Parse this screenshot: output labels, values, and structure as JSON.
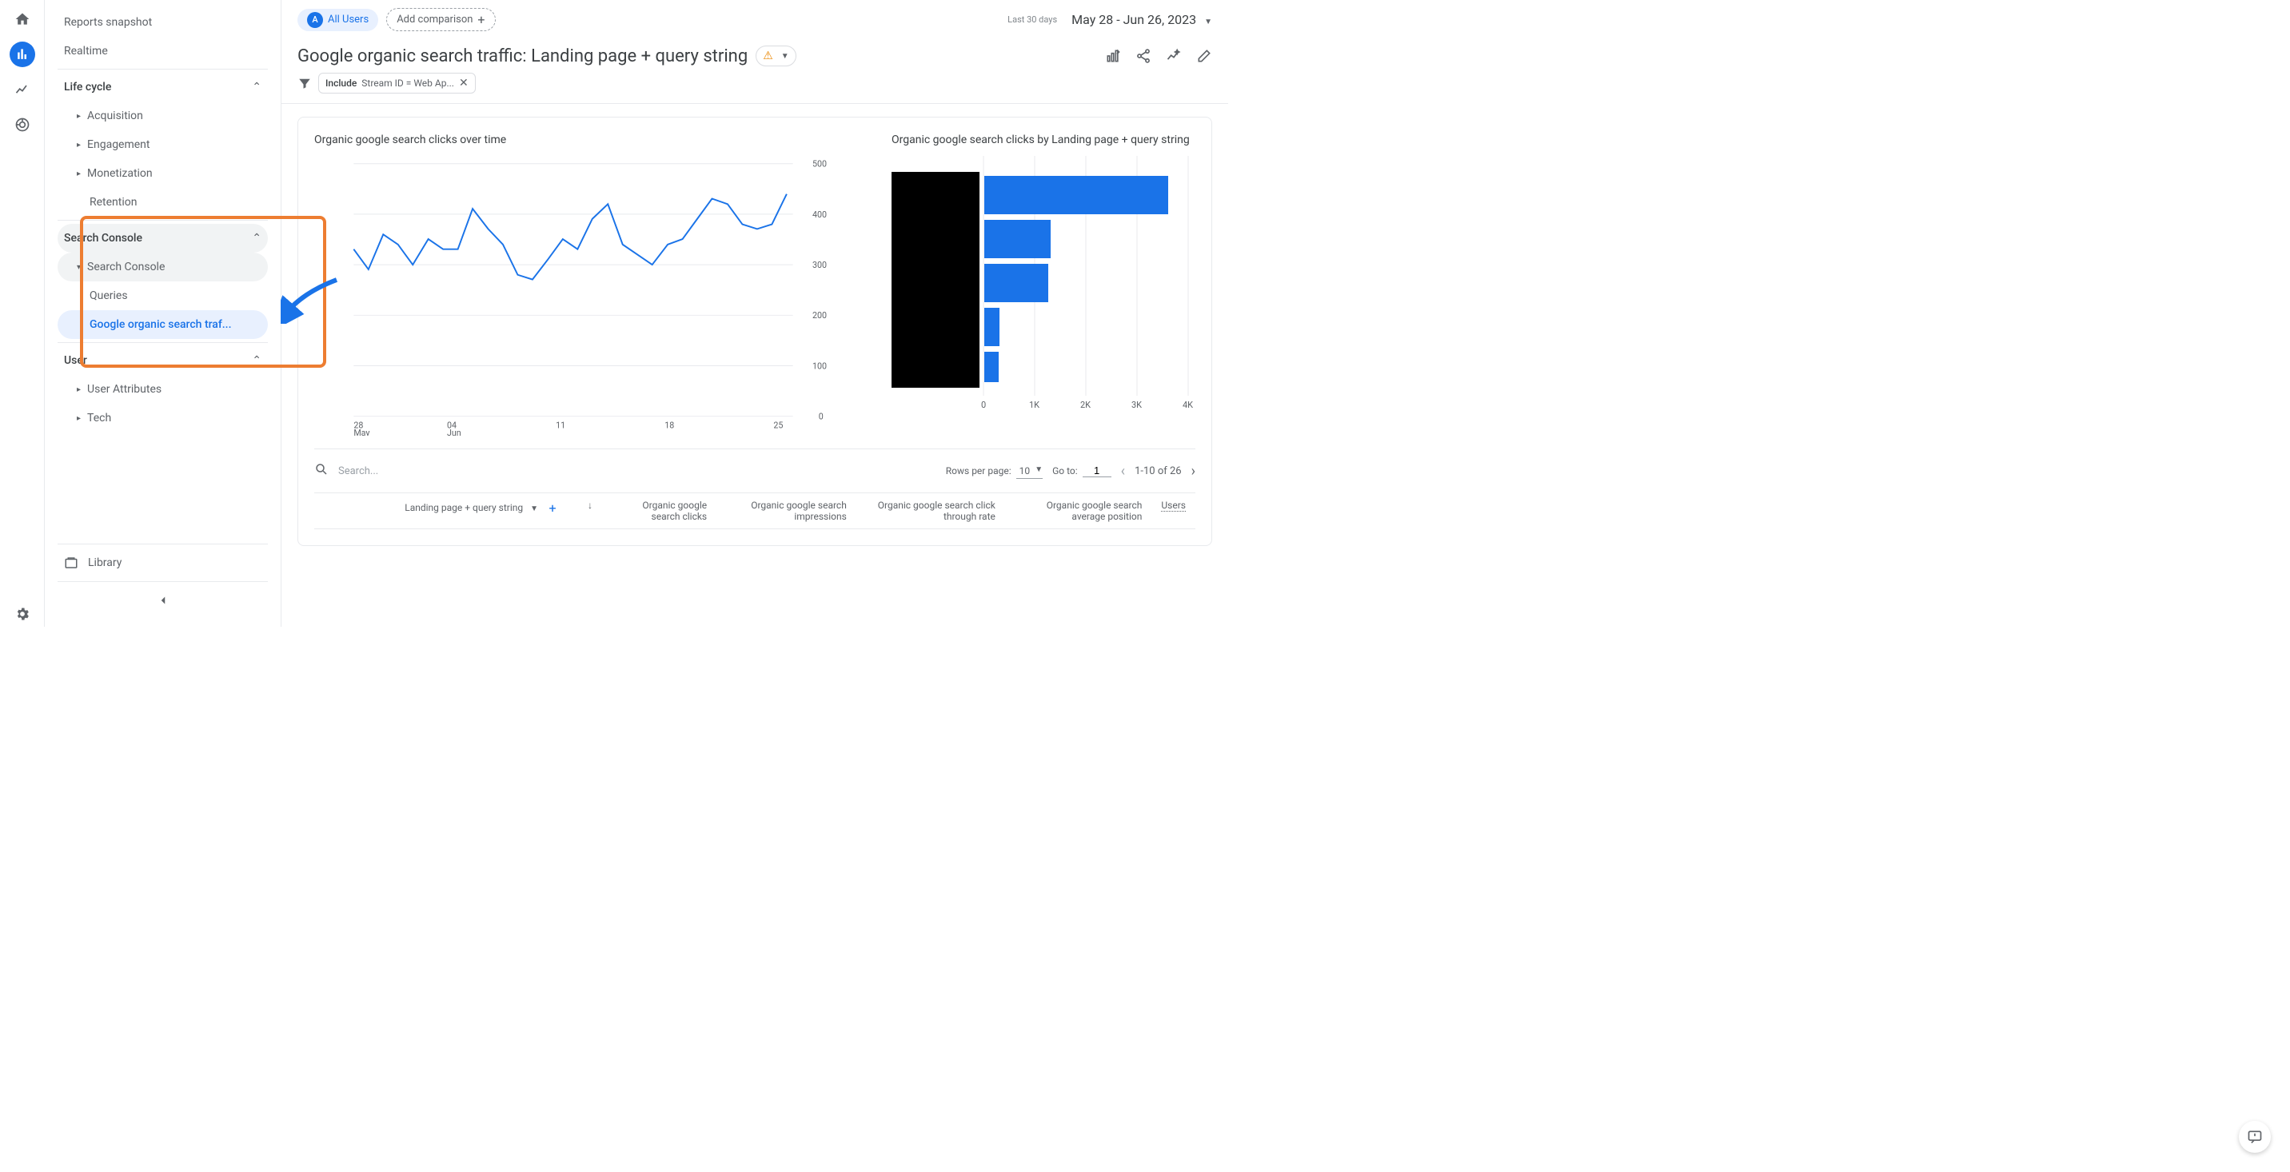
{
  "rail": {},
  "sidebar": {
    "reports_snapshot": "Reports snapshot",
    "realtime": "Realtime",
    "life_cycle": "Life cycle",
    "acquisition": "Acquisition",
    "engagement": "Engagement",
    "monetization": "Monetization",
    "retention": "Retention",
    "search_console_section": "Search Console",
    "search_console_group": "Search Console",
    "queries": "Queries",
    "google_organic": "Google organic search traf...",
    "user_section": "User",
    "user_attributes": "User Attributes",
    "tech": "Tech",
    "library": "Library"
  },
  "topbar": {
    "all_users": "All Users",
    "add_comparison": "Add comparison",
    "date_label": "Last 30 days",
    "date_range": "May 28 - Jun 26, 2023"
  },
  "page": {
    "title": "Google organic search traffic: Landing page + query string",
    "filter_label": "Include",
    "filter_value": "Stream ID = Web Ap..."
  },
  "charts": {
    "line_title": "Organic google search clicks over time",
    "bar_title": "Organic google search clicks by Landing page + query string"
  },
  "chart_data": [
    {
      "type": "line",
      "title": "Organic google search clicks over time",
      "ylabel": "",
      "ylim": [
        0,
        500
      ],
      "yticks": [
        0,
        100,
        200,
        300,
        400,
        500
      ],
      "x_tick_labels": [
        "28 May",
        "04 Jun",
        "11",
        "18",
        "25"
      ],
      "series": [
        {
          "name": "Organic google search clicks",
          "x": [
            0,
            1,
            2,
            3,
            4,
            5,
            6,
            7,
            8,
            9,
            10,
            11,
            12,
            13,
            14,
            15,
            16,
            17,
            18,
            19,
            20,
            21,
            22,
            23,
            24,
            25,
            26,
            27,
            28,
            29
          ],
          "values": [
            330,
            290,
            360,
            340,
            300,
            350,
            330,
            330,
            410,
            370,
            340,
            280,
            270,
            310,
            350,
            330,
            390,
            420,
            340,
            320,
            300,
            340,
            370,
            380,
            430,
            420,
            380,
            370,
            380,
            440
          ]
        }
      ]
    },
    {
      "type": "bar",
      "orientation": "horizontal",
      "title": "Organic google search clicks by Landing page + query string",
      "xlabel": "",
      "xlim": [
        0,
        4000
      ],
      "xticks": [
        0,
        1000,
        2000,
        3000,
        4000
      ],
      "xtick_labels": [
        "0",
        "1K",
        "2K",
        "3K",
        "4K"
      ],
      "categories_redacted": true,
      "values": [
        3600,
        1300,
        1250,
        300,
        280
      ]
    }
  ],
  "table": {
    "search_placeholder": "Search...",
    "rows_per_page_label": "Rows per page:",
    "rows_per_page_value": "10",
    "go_to_label": "Go to:",
    "go_to_value": "1",
    "range": "1-10 of 26",
    "dimension_header": "Landing page + query string",
    "columns": {
      "c1": "Organic google search clicks",
      "c2": "Organic google search impressions",
      "c3": "Organic google search click through rate",
      "c4": "Organic google search average position",
      "c5": "Users"
    }
  }
}
